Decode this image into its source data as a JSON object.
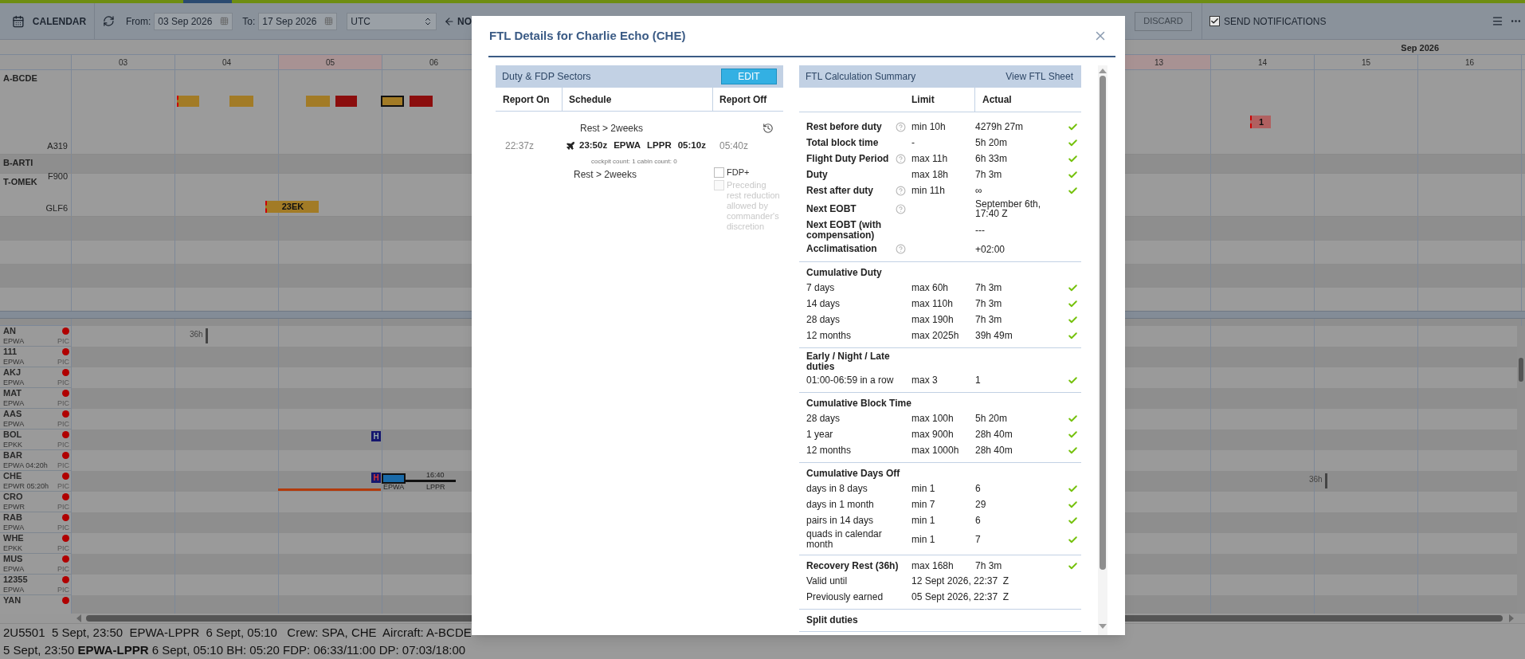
{
  "toolbar": {
    "title": "CALENDAR",
    "from_label": "From:",
    "from_value": "03 Sep 2026",
    "to_label": "To:",
    "to_value": "17 Sep 2026",
    "timezone": "UTC",
    "now_link": "NO",
    "discard": {
      "label": "DISCARD",
      "disabled": true
    },
    "send_notifications": {
      "label": "SEND NOTIFICATIONS",
      "checked": true
    }
  },
  "calendar": {
    "month": "Sep 2026",
    "days_left": [
      {
        "label": "03",
        "weekend": false
      },
      {
        "label": "04",
        "weekend": false
      },
      {
        "label": "05",
        "weekend": true
      },
      {
        "label": "06",
        "weekend": false
      }
    ],
    "days_right": [
      {
        "label": "13",
        "weekend": true
      },
      {
        "label": "14",
        "weekend": false
      },
      {
        "label": "15",
        "weekend": false
      },
      {
        "label": "16",
        "weekend": false
      }
    ],
    "aircraft": [
      {
        "registration": "A-BCDE",
        "type": "A319",
        "events": [
          {
            "kind": "serrated",
            "color": "#a27b26",
            "selected": false
          },
          {
            "kind": "plain",
            "color": "#a27b26",
            "selected": false
          },
          {
            "kind": "plain",
            "color": "#a27b26",
            "selected": false
          },
          {
            "kind": "plain",
            "color": "#8b0d0d",
            "selected": false
          },
          {
            "kind": "plain",
            "color": "#a27b26",
            "selected": true
          },
          {
            "kind": "plain",
            "color": "#8b0d0d",
            "selected": false
          },
          {
            "kind": "serrated",
            "color": "#b06060",
            "selected": false,
            "label": "1"
          }
        ]
      },
      {
        "registration": "B-ARTI",
        "type": "F900"
      },
      {
        "registration": "T-OMEK",
        "type": "GLF6",
        "events": [
          {
            "kind": "serrated",
            "color": "#a27b26",
            "selected": false,
            "label": "23EK"
          }
        ]
      }
    ]
  },
  "crew": [
    {
      "name": "AN",
      "base": "EPWA",
      "role": "PIC",
      "events": [
        {
          "kind": "rest",
          "label": "36h"
        }
      ]
    },
    {
      "name": "111",
      "base": "EPWA",
      "role": "PIC"
    },
    {
      "name": "AKJ",
      "base": "EPWA",
      "role": "PIC"
    },
    {
      "name": "MAT",
      "base": "EPWA",
      "role": "PIC"
    },
    {
      "name": "AAS",
      "base": "EPWA",
      "role": "PIC"
    },
    {
      "name": "BOL",
      "base": "EPKK",
      "role": "PIC",
      "events": [
        {
          "kind": "hotel",
          "label": "H",
          "alert": false
        }
      ]
    },
    {
      "name": "BAR",
      "base": "EPWA 04:20h",
      "role": "PIC"
    },
    {
      "name": "CHE",
      "base": "EPWR 05:20h",
      "role": "PIC",
      "events": [
        {
          "kind": "duty"
        },
        {
          "kind": "hotel",
          "label": "H",
          "alert": true
        },
        {
          "kind": "flight",
          "from": "EPWA",
          "time": "16:40",
          "to": "LPPR"
        },
        {
          "kind": "rest",
          "label": "36h"
        }
      ]
    },
    {
      "name": "CRO",
      "base": "EPWR",
      "role": "PIC"
    },
    {
      "name": "RAB",
      "base": "EPWA",
      "role": "PIC"
    },
    {
      "name": "WHE",
      "base": "EPKK",
      "role": "PIC"
    },
    {
      "name": "MUS",
      "base": "EPWA",
      "role": "PIC"
    },
    {
      "name": "12355",
      "base": "EPWA",
      "role": "PIC"
    },
    {
      "name": "YAN"
    }
  ],
  "status_bar": [
    "2U5501  5 Sept, 23:50  EPWA-LPPR  6 Sept, 05:10   Crew: SPA, CHE  Aircraft: A-BCDE",
    "5 Sept, 23:50 **EPWA-LPPR** 6 Sept, 05:10 BH: 05:20 FDP: 06:33/11:00 DP: 07:03/18:00"
  ],
  "modal": {
    "title": "FTL Details for Charlie Echo (CHE)",
    "sectors": {
      "title": "Duty & FDP Sectors",
      "edit": "EDIT",
      "columns": [
        "Report On",
        "Schedule",
        "Report Off"
      ],
      "rest_before": "Rest > 2weeks",
      "report_on": "22:37z",
      "departure": "23:50z",
      "from": "EPWA",
      "to": "LPPR",
      "arrival": "05:10z",
      "report_off": "05:40z",
      "counts": "cockpit count: 1 cabin count: 0",
      "rest_after": "Rest > 2weeks",
      "options": [
        {
          "label": "FDP+",
          "checked": false,
          "disabled": false
        },
        {
          "label": "Preceding rest reduction allowed by commander's discretion",
          "checked": false,
          "disabled": true
        }
      ]
    },
    "summary": {
      "title": "FTL Calculation Summary",
      "link": "View FTL Sheet",
      "columns": [
        "Limit",
        "Actual"
      ],
      "sections": [
        {
          "kind": "main",
          "rows": [
            {
              "label": "Rest before duty",
              "help": true,
              "limit": "min 10h",
              "actual": "4279h 27m",
              "ok": true
            },
            {
              "label": "Total block time",
              "help": false,
              "limit": "-",
              "actual": "5h 20m",
              "ok": true
            },
            {
              "label": "Flight Duty Period",
              "help": true,
              "limit": "max 11h",
              "actual": "6h 33m",
              "ok": true
            },
            {
              "label": "Duty",
              "help": false,
              "limit": "max 18h",
              "actual": "7h 3m",
              "ok": true
            },
            {
              "label": "Rest after duty",
              "help": true,
              "limit": "min 11h",
              "actual": "∞",
              "ok": true
            },
            {
              "label": "Next EOBT",
              "help": true,
              "actual": "September 6th, 17:40 Z",
              "ok": false
            },
            {
              "label": "Next EOBT (with compensation)",
              "help": false,
              "actual": "---",
              "ok": false
            },
            {
              "label": "Acclimatisation",
              "help": true,
              "actual": "+02:00",
              "ok": false
            }
          ]
        },
        {
          "kind": "group",
          "title": "Cumulative Duty",
          "rows": [
            {
              "label": "7 days",
              "limit": "max 60h",
              "actual": "7h 3m",
              "ok": true
            },
            {
              "label": "14 days",
              "limit": "max 110h",
              "actual": "7h 3m",
              "ok": true
            },
            {
              "label": "28 days",
              "limit": "max 190h",
              "actual": "7h 3m",
              "ok": true
            },
            {
              "label": "12 months",
              "limit": "max 2025h",
              "actual": "39h 49m",
              "ok": true
            }
          ]
        },
        {
          "kind": "group",
          "title": "Early / Night / Late duties",
          "rows": [
            {
              "label": "01:00-06:59 in a row",
              "limit": "max 3",
              "actual": "1",
              "ok": true
            }
          ]
        },
        {
          "kind": "group",
          "title": "Cumulative Block Time",
          "rows": [
            {
              "label": "28 days",
              "limit": "max 100h",
              "actual": "5h 20m",
              "ok": true
            },
            {
              "label": "1 year",
              "limit": "max 900h",
              "actual": "28h 40m",
              "ok": true
            },
            {
              "label": "12 months",
              "limit": "max 1000h",
              "actual": "28h 40m",
              "ok": true
            }
          ]
        },
        {
          "kind": "group",
          "title": "Cumulative Days Off",
          "rows": [
            {
              "label": "days in 8 days",
              "limit": "min 1",
              "actual": "6",
              "ok": true
            },
            {
              "label": "days in 1 month",
              "limit": "min 7",
              "actual": "29",
              "ok": true
            },
            {
              "label": "pairs in 14 days",
              "limit": "min 1",
              "actual": "6",
              "ok": true
            },
            {
              "label": "quads in calendar month",
              "limit": "min 1",
              "actual": "7",
              "ok": true
            }
          ]
        },
        {
          "kind": "group",
          "title": "Recovery Rest (36h)",
          "limit": "max 168h",
          "actual": "7h 3m",
          "ok": true,
          "rows": [
            {
              "label": "Valid until",
              "value": "12 Sept 2026, 22:37  Z",
              "ok": false
            },
            {
              "label": "Previously earned",
              "value": "05 Sept 2026, 22:37  Z",
              "ok": false
            }
          ]
        },
        {
          "kind": "group",
          "title": "Split duties"
        }
      ]
    }
  }
}
